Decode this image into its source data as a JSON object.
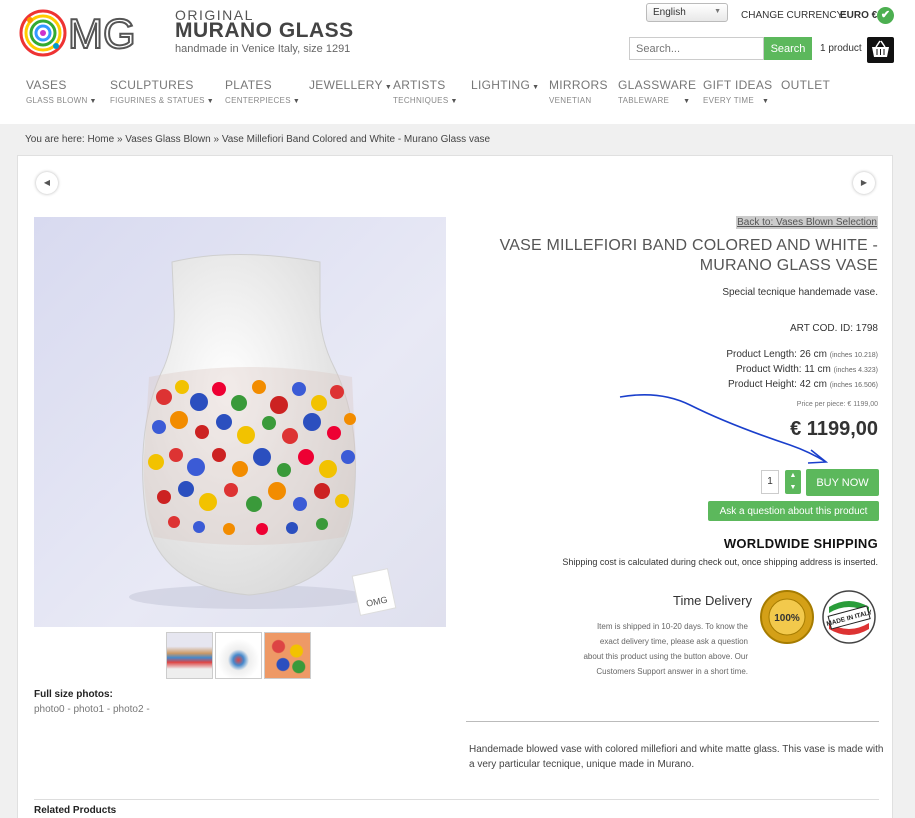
{
  "header": {
    "brand_original": "ORIGINAL",
    "brand_name": "MURANO GLASS",
    "brand_tagline": "handmade in Venice Italy, size 1291",
    "language": "English",
    "currency_label": "CHANGE CURRENCY:",
    "currency_value": "EURO €",
    "search_placeholder": "Search...",
    "search_button": "Search",
    "cart_count": "1 product"
  },
  "nav": {
    "items": [
      {
        "label": "VASES",
        "sub": "GLASS BLOWN"
      },
      {
        "label": "SCULPTURES",
        "sub": "FIGURINES & STATUES"
      },
      {
        "label": "PLATES",
        "sub": "CENTERPIECES"
      },
      {
        "label": "JEWELLERY",
        "sub": ""
      },
      {
        "label": "ARTISTS",
        "sub": "TECHNIQUES"
      },
      {
        "label": "LIGHTING",
        "sub": ""
      },
      {
        "label": "MIRRORS",
        "sub": "VENETIAN"
      },
      {
        "label": "GLASSWARE",
        "sub": "TABLEWARE"
      },
      {
        "label": "GIFT IDEAS",
        "sub": "EVERY TIME"
      },
      {
        "label": "OUTLET",
        "sub": ""
      }
    ]
  },
  "breadcrumb": {
    "prefix": "You are here:",
    "home": "Home",
    "sep1": "»",
    "category": "Vases Glass Blown",
    "sep2": "»",
    "current": "Vase Millefiori Band Colored and White - Murano Glass vase"
  },
  "product": {
    "back_link": "Back to: Vases Blown Selection",
    "title": "VASE MILLEFIORI BAND COLORED AND WHITE - MURANO GLASS VASE",
    "tagline": "Special tecnique handemade vase.",
    "art_cod": "ART COD. ID: 1798",
    "length": "Product Length: 26 cm",
    "length_in": "(inches 10.218)",
    "width": "Product Width: 11 cm",
    "width_in": "(inches 4.323)",
    "height": "Product Height: 42 cm",
    "height_in": "(inches 16.506)",
    "price_per_piece": "Price per piece: € 1199,00",
    "price": "€ 1199,00",
    "quantity": "1",
    "buy_now": "BUY NOW",
    "ask_question": "Ask a question about this product",
    "shipping_title": "WORLDWIDE SHIPPING",
    "shipping_text": "Shipping cost is calculated during check out, once shipping address is inserted.",
    "time_delivery_title": "Time Delivery",
    "time_delivery_text": "Item is shipped in 10-20 days. To know the exact delivery time, please ask a question about this product using the button above. Our Customers Support answer in a short time.",
    "badge_money_back": "MONEY BACK 100% GUARANTEE",
    "badge_made_in_italy": "MADE IN ITALY",
    "description": "Handemade blowed vase with colored millefiori and white matte glass. This vase is made with a very particular tecnique, unique made in Murano.",
    "fullsize_label": "Full size photos:",
    "fullsize_links": [
      "photo0",
      "photo1",
      "photo2"
    ],
    "related_title": "Related Products"
  },
  "colors": {
    "accent_green": "#5cb85c",
    "annotation_blue": "#1a3fcc"
  }
}
